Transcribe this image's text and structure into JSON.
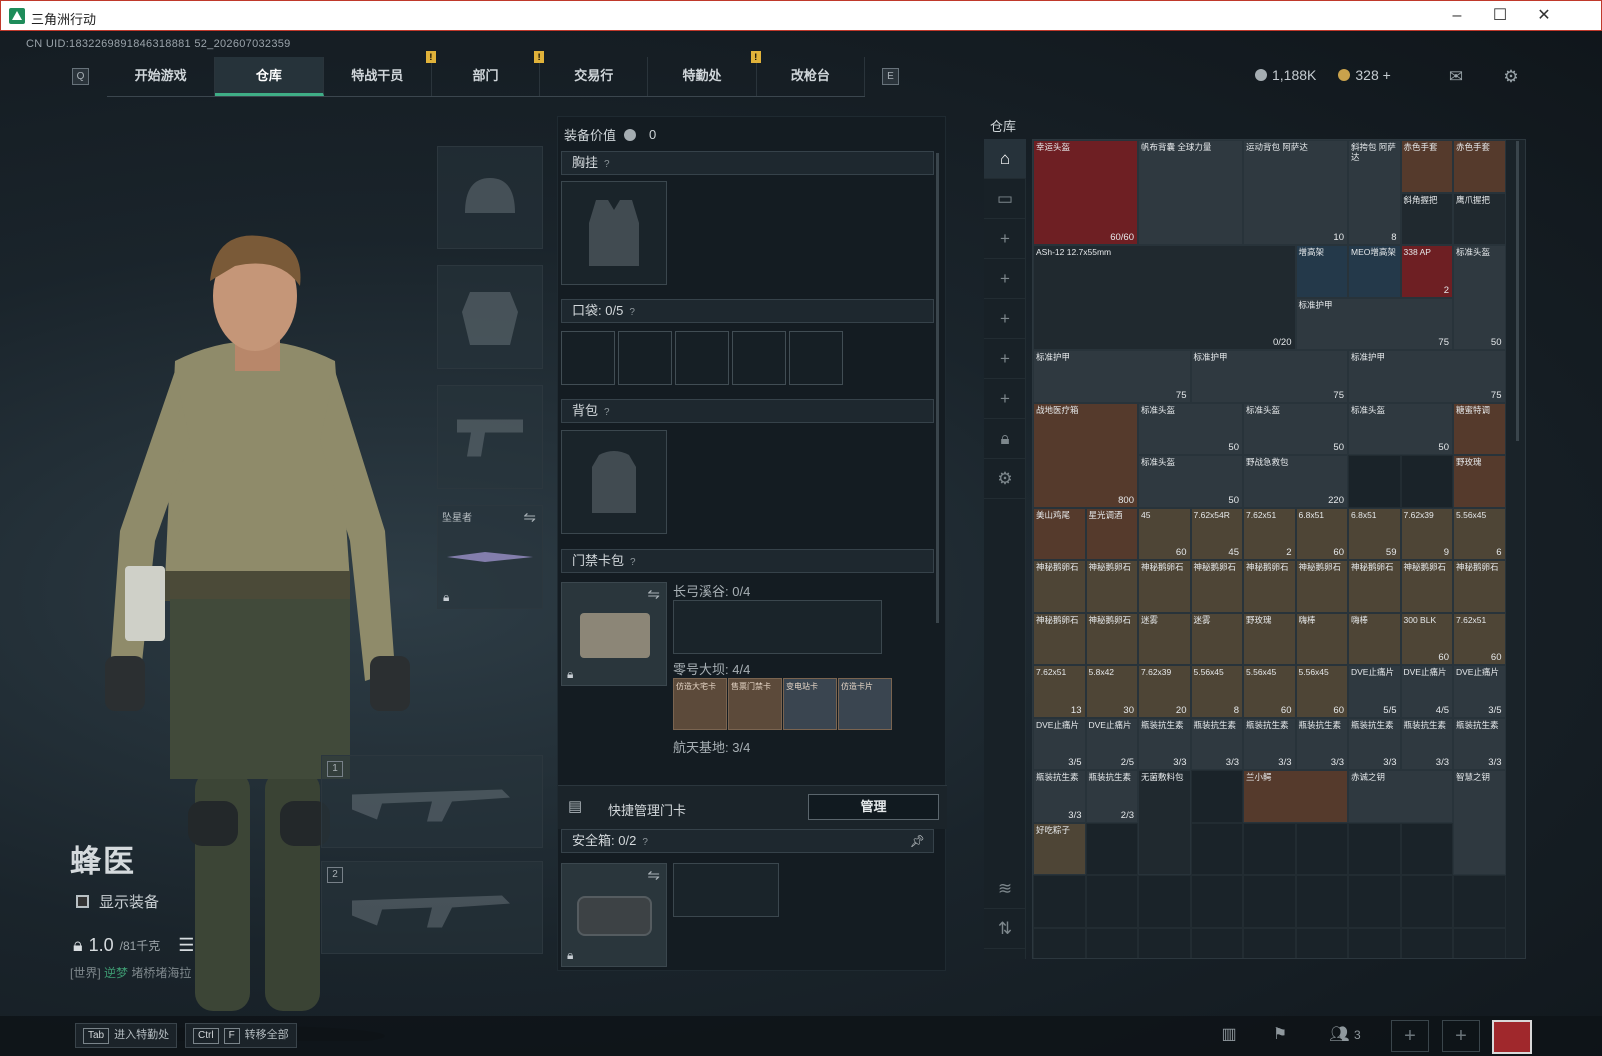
{
  "window": {
    "title": "三角洲行动"
  },
  "uid": "CN UID:1832269891846318881 52_202607032359",
  "nav": {
    "key_left": "Q",
    "key_right": "E",
    "tabs": [
      "开始游戏",
      "仓库",
      "特战干员",
      "部门",
      "交易行",
      "特勤处",
      "改枪台"
    ],
    "active": "仓库"
  },
  "currency": {
    "silver": "1,188K",
    "gold": "328"
  },
  "character": {
    "name": "蜂医",
    "show_equipment": "显示装备",
    "weight": "1.0",
    "weight_max": "/81千克",
    "world_tag": "[世界]",
    "world_user": "逆梦",
    "world_msg": "堵桥堵海拉"
  },
  "equip": {
    "melee_label": "坠星者",
    "weapon1": "1",
    "weapon2": "2"
  },
  "loadout": {
    "value_label": "装备价值",
    "value": "0",
    "chest": "胸挂",
    "pocket": "口袋:",
    "pocket_val": "0/5",
    "backpack": "背包",
    "keycard_bag": "门禁卡包",
    "maps": [
      {
        "name": "长弓溪谷:",
        "val": "0/4"
      },
      {
        "name": "零号大坝:",
        "val": "4/4"
      },
      {
        "name": "航天基地:",
        "val": "3/4"
      }
    ],
    "cards": [
      "仿造大宅卡",
      "售票门禁卡",
      "变电站卡",
      "仿造卡片"
    ],
    "quick_manage": "快捷管理门卡",
    "manage_btn": "管理",
    "safe": "安全箱:",
    "safe_val": "0/2"
  },
  "warehouse": {
    "title": "仓库",
    "items": [
      {
        "n": "幸运头盔",
        "c": "60/60"
      },
      {
        "n": "帆布背囊 全球力量",
        "c": ""
      },
      {
        "n": "运动背包 阿萨达",
        "c": "10"
      },
      {
        "n": "斜挎包 阿萨达",
        "c": "8"
      },
      {
        "n": "赤色手套",
        "c": ""
      },
      {
        "n": "赤色手套",
        "c": ""
      },
      {
        "n": "斜角握把",
        "c": ""
      },
      {
        "n": "鹰爪握把",
        "c": ""
      },
      {
        "n": "ASh-12 12.7x55mm",
        "c": "0/20"
      },
      {
        "n": "增高架",
        "c": ""
      },
      {
        "n": "MEO增高架",
        "c": ""
      },
      {
        "n": "338 AP",
        "c": "2"
      },
      {
        "n": "标准头盔",
        "c": "50"
      },
      {
        "n": "标准护甲",
        "c": "75"
      },
      {
        "n": "标准护甲",
        "c": "75"
      },
      {
        "n": "标准护甲",
        "c": "75"
      },
      {
        "n": "标准护甲",
        "c": "75"
      },
      {
        "n": "战地医疗箱",
        "c": "800"
      },
      {
        "n": "标准头盔",
        "c": "50"
      },
      {
        "n": "标准头盔",
        "c": "50"
      },
      {
        "n": "标准头盔",
        "c": "50"
      },
      {
        "n": "糖蜜特调",
        "c": ""
      },
      {
        "n": "标准头盔",
        "c": "50"
      },
      {
        "n": "野战急救包",
        "c": "220"
      },
      {
        "n": "野玫瑰",
        "c": ""
      },
      {
        "n": "美山鸡尾",
        "c": ""
      },
      {
        "n": "星光调酒",
        "c": ""
      },
      {
        "n": "45",
        "c": "60"
      },
      {
        "n": "7.62x54R",
        "c": "45"
      },
      {
        "n": "7.62x51",
        "c": "2"
      },
      {
        "n": "6.8x51",
        "c": "60"
      },
      {
        "n": "6.8x51",
        "c": "59"
      },
      {
        "n": "7.62x39",
        "c": "9"
      },
      {
        "n": "5.56x45",
        "c": "6"
      },
      {
        "n": "神秘鹅卵石",
        "c": ""
      },
      {
        "n": "神秘鹅卵石",
        "c": ""
      },
      {
        "n": "神秘鹅卵石",
        "c": ""
      },
      {
        "n": "神秘鹅卵石",
        "c": ""
      },
      {
        "n": "神秘鹅卵石",
        "c": ""
      },
      {
        "n": "神秘鹅卵石",
        "c": ""
      },
      {
        "n": "神秘鹅卵石",
        "c": ""
      },
      {
        "n": "神秘鹅卵石",
        "c": ""
      },
      {
        "n": "神秘鹅卵石",
        "c": ""
      },
      {
        "n": "神秘鹅卵石",
        "c": ""
      },
      {
        "n": "神秘鹅卵石",
        "c": ""
      },
      {
        "n": "迷雾",
        "c": ""
      },
      {
        "n": "迷雾",
        "c": ""
      },
      {
        "n": "野玫瑰",
        "c": ""
      },
      {
        "n": "嗨棒",
        "c": ""
      },
      {
        "n": "嗨棒",
        "c": ""
      },
      {
        "n": "300 BLK",
        "c": "60"
      },
      {
        "n": "7.62x51",
        "c": "60"
      },
      {
        "n": "7.62x51",
        "c": "13"
      },
      {
        "n": "5.8x42",
        "c": "30"
      },
      {
        "n": "7.62x39",
        "c": "20"
      },
      {
        "n": "5.56x45",
        "c": "8"
      },
      {
        "n": "5.56x45",
        "c": "60"
      },
      {
        "n": "5.56x45",
        "c": "60"
      },
      {
        "n": "DVE止痛片",
        "c": "5/5"
      },
      {
        "n": "DVE止痛片",
        "c": "4/5"
      },
      {
        "n": "DVE止痛片",
        "c": "3/5"
      },
      {
        "n": "DVE止痛片",
        "c": "3/5"
      },
      {
        "n": "DVE止痛片",
        "c": "2/5"
      },
      {
        "n": "瓶装抗生素",
        "c": "3/3"
      },
      {
        "n": "瓶装抗生素",
        "c": "3/3"
      },
      {
        "n": "瓶装抗生素",
        "c": "3/3"
      },
      {
        "n": "瓶装抗生素",
        "c": "3/3"
      },
      {
        "n": "瓶装抗生素",
        "c": "3/3"
      },
      {
        "n": "瓶装抗生素",
        "c": "3/3"
      },
      {
        "n": "瓶装抗生素",
        "c": "3/3"
      },
      {
        "n": "瓶装抗生素",
        "c": "3/3"
      },
      {
        "n": "瓶装抗生素",
        "c": "2/3"
      },
      {
        "n": "无菌敷料包",
        "c": ""
      },
      {
        "n": "兰小鳄",
        "c": ""
      },
      {
        "n": "赤诚之钥",
        "c": ""
      },
      {
        "n": "智慧之钥",
        "c": ""
      },
      {
        "n": "好吃粽子",
        "c": ""
      }
    ]
  },
  "bottom": {
    "hint1_key": "Tab",
    "hint1": "进入特勤处",
    "hint2_key1": "Ctrl",
    "hint2_key2": "F",
    "hint2": "转移全部",
    "squad_count": "3"
  },
  "colors": {
    "accent": "#3fae86",
    "warning": "#e0b23a"
  }
}
